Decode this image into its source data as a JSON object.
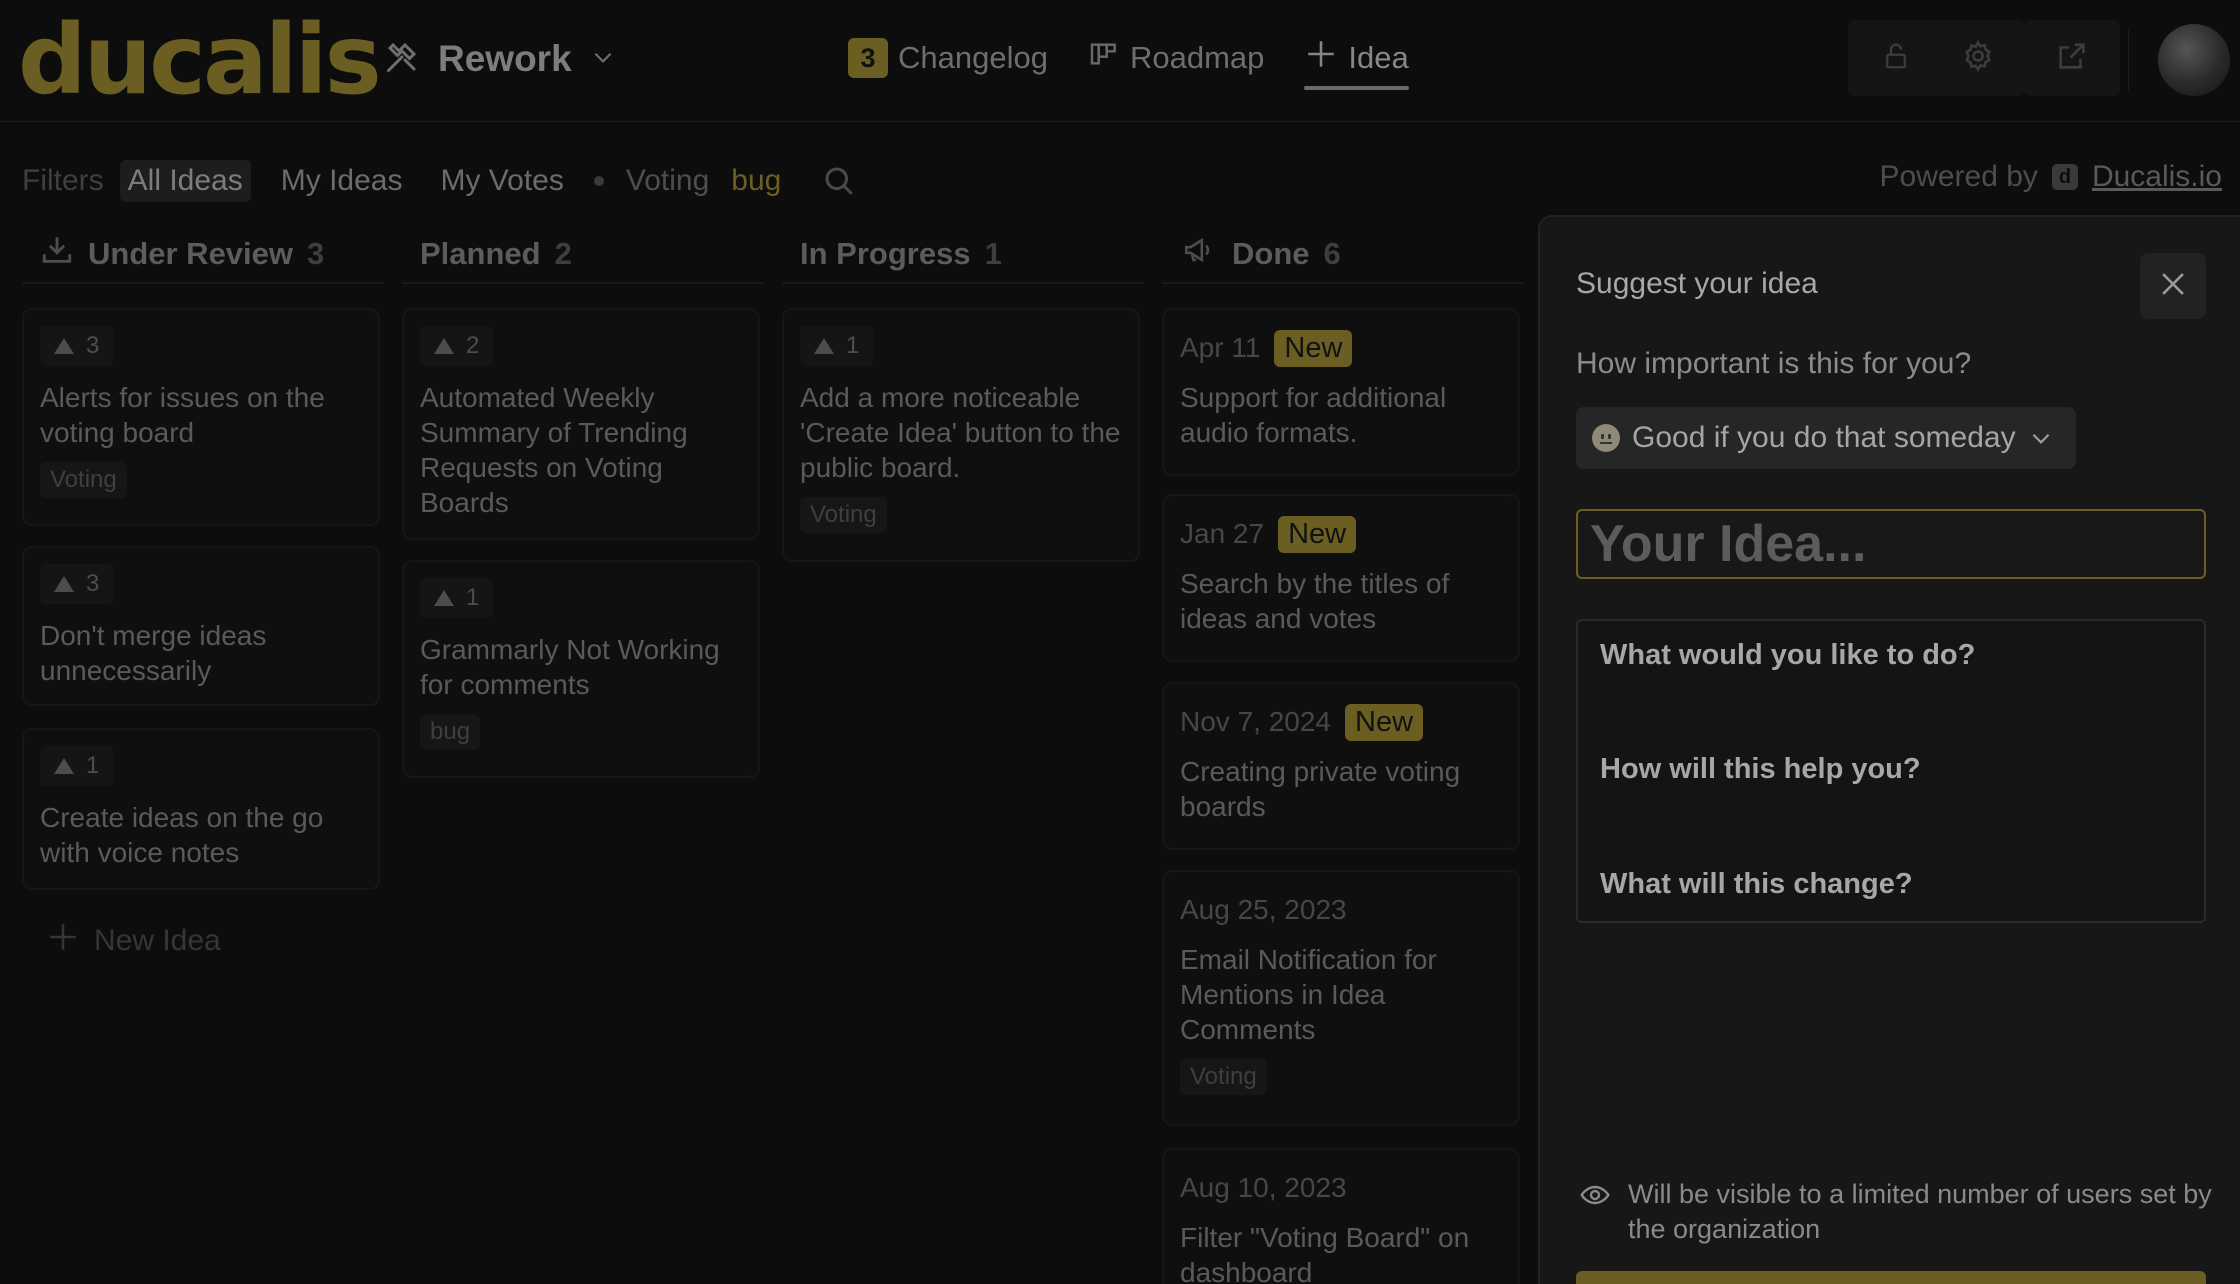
{
  "brand": {
    "logo_text": "ducalis",
    "accent_color": "#6b5e22"
  },
  "header": {
    "project_icon": "tools-icon",
    "project_name": "Rework",
    "nav": {
      "changelog_count": "3",
      "changelog_label": "Changelog",
      "roadmap_label": "Roadmap",
      "idea_label": "Idea"
    },
    "actions": [
      "lock-icon",
      "gear-icon",
      "external-link-icon"
    ]
  },
  "filters": {
    "label": "Filters",
    "options": [
      "All Ideas",
      "My Ideas",
      "My Votes"
    ],
    "active": "All Ideas",
    "tags": [
      "Voting",
      "bug"
    ]
  },
  "powered": {
    "text": "Powered by",
    "link": "Ducalis.io"
  },
  "columns": [
    {
      "title": "Under Review",
      "count": "3",
      "cards": [
        {
          "votes": "3",
          "title": "Alerts for issues on the voting board",
          "tag": "Voting"
        },
        {
          "votes": "3",
          "title": "Don't merge ideas unnecessarily"
        },
        {
          "votes": "1",
          "title": "Create ideas on the go with voice notes"
        }
      ],
      "new_idea": "New Idea"
    },
    {
      "title": "Planned",
      "count": "2",
      "cards": [
        {
          "votes": "2",
          "title": "Automated Weekly Summary of Trending Requests on Voting Boards"
        },
        {
          "votes": "1",
          "title": "Grammarly Not Working for comments",
          "tag": "bug"
        }
      ]
    },
    {
      "title": "In Progress",
      "count": "1",
      "cards": [
        {
          "votes": "1",
          "title": "Add a more noticeable 'Create Idea' button to the public board.",
          "tag": "Voting"
        }
      ]
    },
    {
      "title": "Done",
      "count": "6",
      "cards": [
        {
          "date": "Apr 11",
          "badge": "New",
          "title": "Support for additional audio formats."
        },
        {
          "date": "Jan 27",
          "badge": "New",
          "title": "Search by the titles of ideas and votes"
        },
        {
          "date": "Nov 7, 2024",
          "badge": "New",
          "title": "Creating private voting boards"
        },
        {
          "date": "Aug 25, 2023",
          "title": "Email Notification for Mentions in Idea Comments",
          "tag": "Voting"
        },
        {
          "date": "Aug 10, 2023",
          "title": "Filter \"Voting Board\" on dashboard"
        }
      ]
    }
  ],
  "panel": {
    "title": "Suggest your idea",
    "importance_label": "How important is this for you?",
    "importance_value": "Good if you do that someday",
    "idea_placeholder": "Your Idea...",
    "prompts": [
      "What would you like to do?",
      "How will this help you?",
      "What will this change?"
    ],
    "visibility_note": "Will be visible to a limited number of users set by the organization"
  }
}
